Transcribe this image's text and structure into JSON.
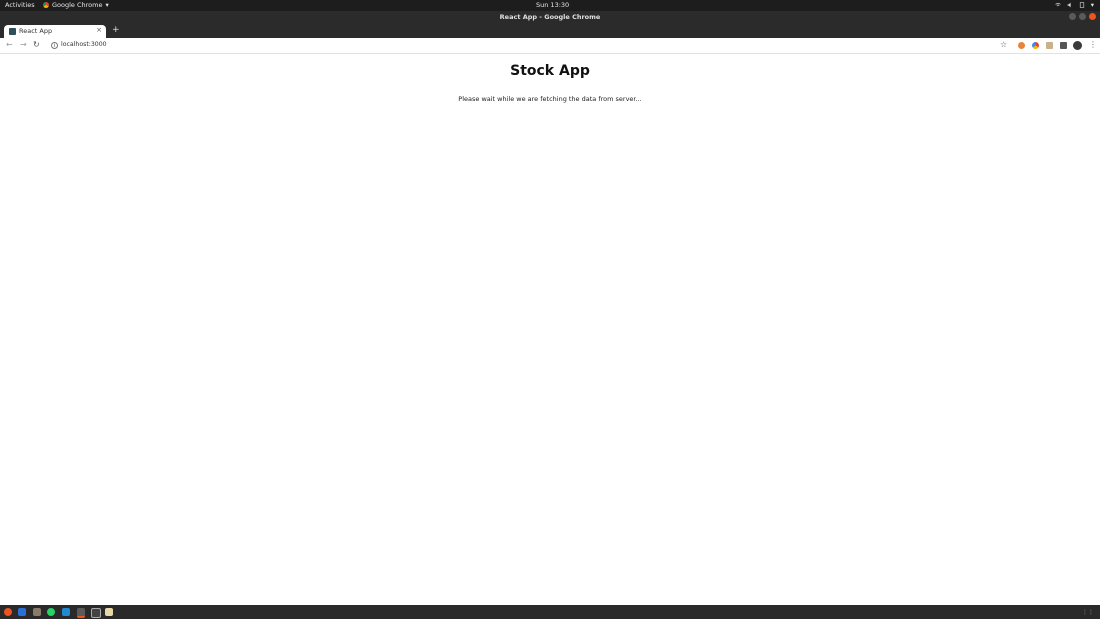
{
  "topbar": {
    "activities": "Activities",
    "app_menu": "Google Chrome",
    "clock": "Sun 13:30"
  },
  "window": {
    "title": "React App - Google Chrome"
  },
  "tab": {
    "label": "React App",
    "close": "×",
    "new_tab": "+"
  },
  "toolbar": {
    "back": "←",
    "forward": "→",
    "reload": "↻",
    "url": "localhost:3000",
    "star": "☆",
    "menu": "⋮"
  },
  "page": {
    "title": "Stock App",
    "message": "Please wait while we are fetching the data from server..."
  },
  "colors": {
    "close_button": "#e9541f",
    "topbar": "#1d1d1d",
    "titlebar": "#2b2b2b"
  }
}
